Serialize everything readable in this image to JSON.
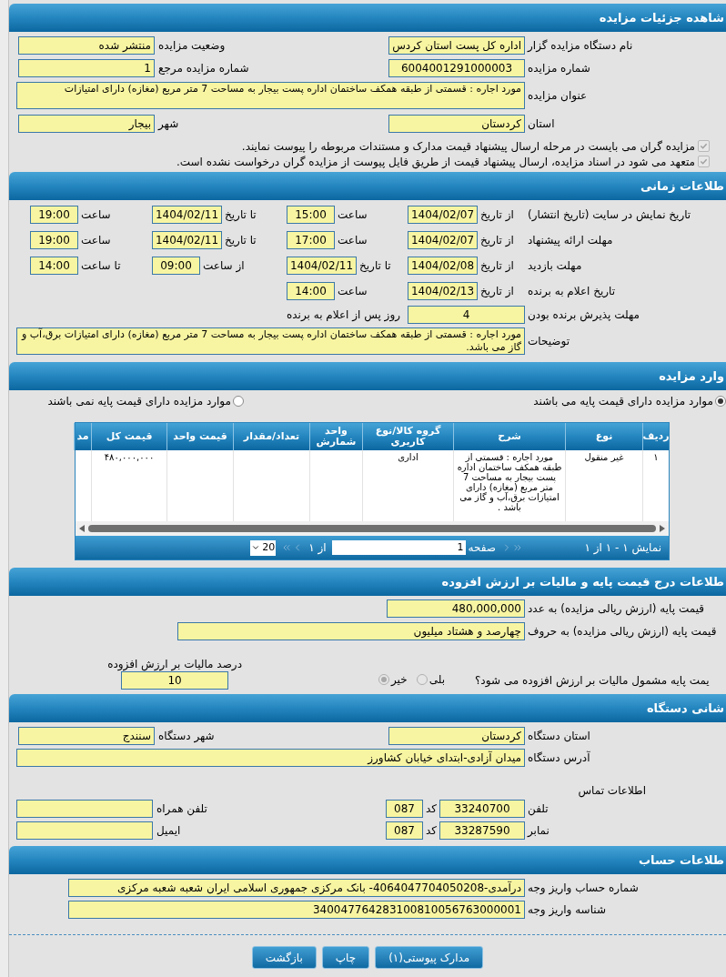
{
  "details": {
    "title": "شاهده جزئیات مزایده",
    "organizer": {
      "label": "نام دستگاه مزایده گزار",
      "value": "اداره کل پست استان کردس"
    },
    "status": {
      "label": "وضعیت مزایده",
      "value": "منتشر شده"
    },
    "number": {
      "label": "شماره مزایده",
      "value": "6004001291000003"
    },
    "ref_number": {
      "label": "شماره مزایده مرجع",
      "value": "1"
    },
    "subject": {
      "label": "عنوان مزایده",
      "value": "مورد اجاره : قسمتی از طبقه همکف ساختمان اداره  پست بیجار به مساحت 7 متر مربع (مغازه) دارای امتیازات"
    },
    "province": {
      "label": "استان",
      "value": "کردستان"
    },
    "city": {
      "label": "شهر",
      "value": "بیجار"
    },
    "checks": [
      {
        "label": "مزایده گران می بایست در مرحله ارسال پیشنهاد قیمت مدارک و مستندات مربوطه را پیوست نمایند.",
        "checked": true,
        "disabled": true
      },
      {
        "label": "متعهد می شود در اسناد مزایده، ارسال پیشنهاد قیمت از طریق فایل پیوست از مزایده گران درخواست نشده است.",
        "checked": true,
        "disabled": true
      }
    ]
  },
  "schedule": {
    "title": "طلاعات زمانی",
    "rows": [
      {
        "label": "تاریخ نمایش در سایت (تاریخ انتشار)",
        "parts": [
          {
            "label": "از تاریخ",
            "value": "1404/02/07"
          },
          {
            "label": "ساعت",
            "value": "15:00"
          },
          {
            "label": "تا تاریخ",
            "value": "1404/02/11"
          },
          {
            "label": "ساعت",
            "value": "19:00"
          }
        ]
      },
      {
        "label": "مهلت ارائه پیشنهاد",
        "parts": [
          {
            "label": "از تاریخ",
            "value": "1404/02/07"
          },
          {
            "label": "ساعت",
            "value": "17:00"
          },
          {
            "label": "تا تاریخ",
            "value": "1404/02/11"
          },
          {
            "label": "ساعت",
            "value": "19:00"
          }
        ]
      },
      {
        "label": "مهلت بازدید",
        "parts": [
          {
            "label": "از تاریخ",
            "value": "1404/02/08"
          },
          {
            "label": "تا تاریخ",
            "value": "1404/02/11"
          },
          {
            "label": "از ساعت",
            "value": "09:00"
          },
          {
            "label": "تا ساعت",
            "value": "14:00"
          }
        ]
      },
      {
        "label": "تاریخ اعلام به برنده",
        "parts": [
          {
            "label": "از تاریخ",
            "value": "1404/02/13"
          },
          {
            "label": "ساعت",
            "value": "14:00"
          }
        ]
      }
    ],
    "acceptance": {
      "label": "مهلت پذیرش برنده بودن",
      "value": "4",
      "suffix": "روز پس از اعلام به برنده"
    },
    "description": {
      "label": "توضیحات",
      "value": "مورد اجاره : قسمتی از طبقه همکف ساختمان اداره  پست بیجار به مساحت 7 متر مربع (مغازه) دارای امتیازات برق،آب و گاز می باشد."
    }
  },
  "items": {
    "title": "وارد مزایده",
    "filters": [
      {
        "label": "موارد مزایده دارای قیمت پایه می باشند",
        "selected": true
      },
      {
        "label": "موارد مزایده دارای قیمت پایه نمی باشند",
        "selected": false
      }
    ],
    "table": {
      "columns": [
        "ردیف",
        "نوع",
        "شرح",
        "گروه کالا/نوع کاربری",
        "واحد شمارش",
        "تعداد/مقدار",
        "قیمت واحد",
        "قیمت کل",
        "مد"
      ],
      "rows": [
        [
          "۱",
          "غیر منقول",
          "مورد اجاره : قسمتی از طبقه همکف ساختمان اداره  پست بیجار به مساحت 7 متر مربع (مغازه) دارای امتیازات برق،آب و گاز می باشد .",
          "اداری",
          null,
          null,
          null,
          "۴۸۰,۰۰۰,۰۰۰",
          null
        ]
      ]
    },
    "pager": {
      "summary": "نمایش ۱ - ۱ از ۱",
      "page_label": "صفحه",
      "page": "1",
      "of": "از ۱",
      "page_size": "20"
    }
  },
  "pricing": {
    "title": "طلاعات درج قیمت پایه و مالیات بر ارزش افزوده",
    "base_number": {
      "label": "قیمت پایه (ارزش ریالی مزایده) به عدد",
      "value": "480,000,000"
    },
    "base_words": {
      "label": "قیمت پایه (ارزش ریالی مزایده) به حروف",
      "value": "چهارصد و هشتاد میلیون"
    },
    "vat_question": {
      "label": "یمت پایه مشمول مالیات بر ارزش افزوده می شود؟",
      "options": [
        {
          "label": "بلی",
          "selected": false
        },
        {
          "label": "خیر",
          "selected": true
        }
      ]
    },
    "vat_percent": {
      "label": "درصد مالیات بر ارزش افزوده",
      "value": "10"
    }
  },
  "address": {
    "title": "شانی دستگاه",
    "province": {
      "label": "استان دستگاه",
      "value": "کردستان"
    },
    "city": {
      "label": "شهر دستگاه",
      "value": "سنندج"
    },
    "address": {
      "label": "آدرس دستگاه",
      "value": "میدان آزادی-ابتدای خیابان کشاورز"
    },
    "contact_title": "اطلاعات تماس",
    "phone": {
      "label": "تلفن",
      "value": "33240700",
      "code_label": "کد",
      "code": "087"
    },
    "mobile": {
      "label": "تلفن همراه"
    },
    "fax": {
      "label": "نمابر",
      "value": "33287590",
      "code_label": "کد",
      "code": "087"
    },
    "email": {
      "label": "ایمیل"
    }
  },
  "account": {
    "title": "طلاعات حساب",
    "number": {
      "label": "شماره حساب واریز وجه",
      "value": "درآمدی-4064047704050208- بانک مرکزی جمهوری اسلامی ایران شعبه شعبه مرکزی"
    },
    "id": {
      "label": "شناسه واریز وجه",
      "value": "340047764283100810056763000001"
    }
  },
  "buttons": [
    "مدارک پیوستی(۱)",
    "چاپ",
    "بازگشت"
  ]
}
